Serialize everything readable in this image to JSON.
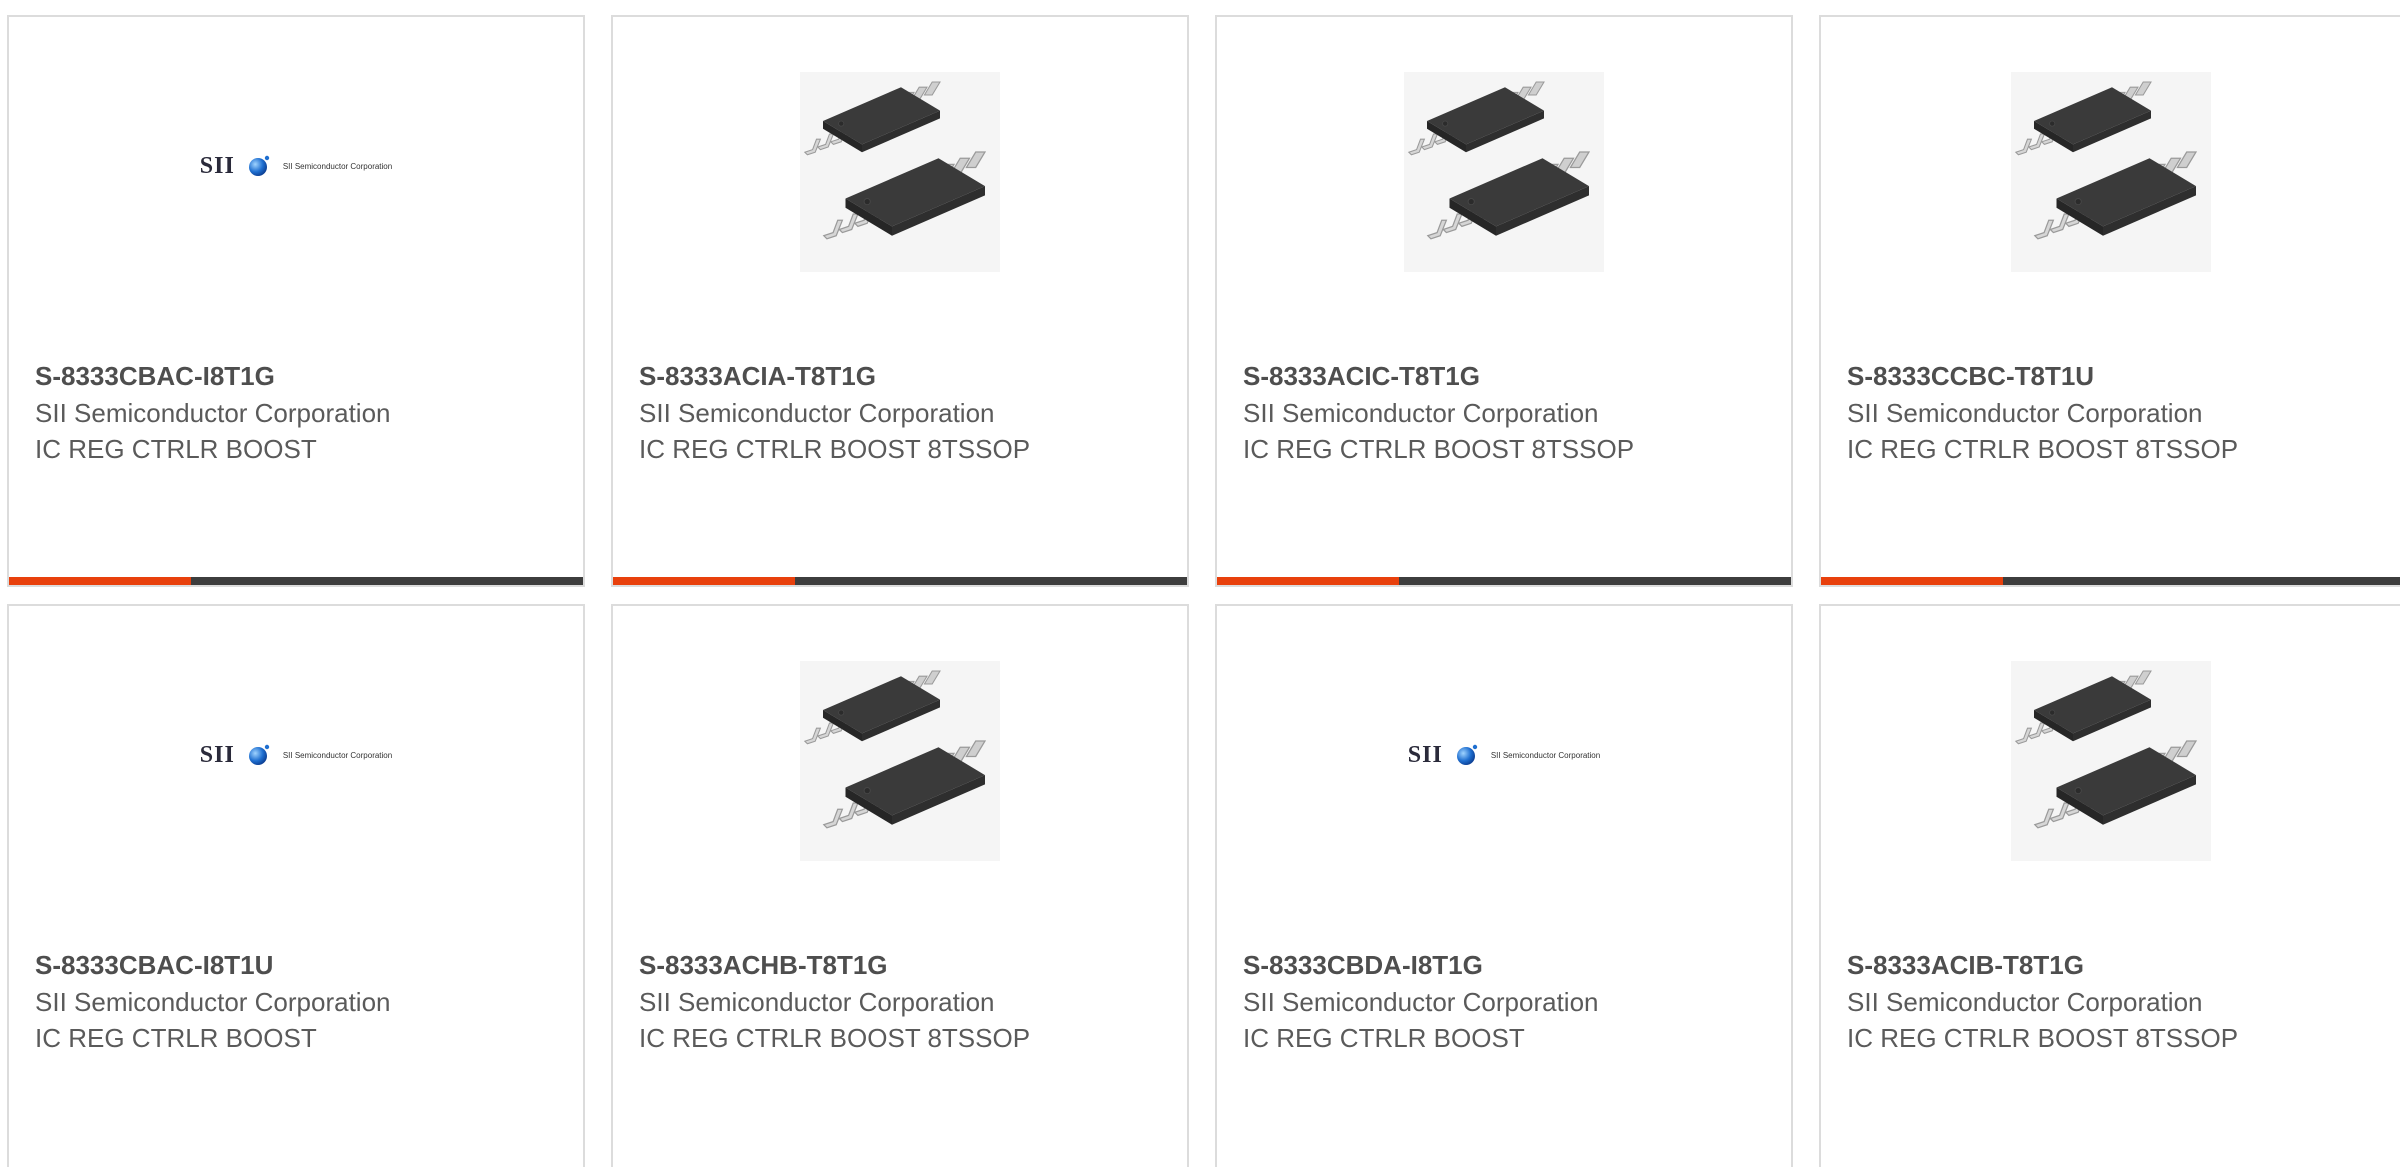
{
  "colors": {
    "accent": "#e8400c",
    "bar_dark": "#3d3d3d",
    "border": "#dcdcdc",
    "title": "#4e4e4e",
    "text": "#5a5a5a"
  },
  "products": [
    {
      "part_number": "S-8333CBAC-I8T1G",
      "manufacturer": "SII Semiconductor Corporation",
      "description": "IC REG CTRLR BOOST",
      "image": "sii-logo",
      "logo_text": "SII",
      "logo_sub": "SII Semiconductor Corporation"
    },
    {
      "part_number": "S-8333ACIA-T8T1G",
      "manufacturer": "SII Semiconductor Corporation",
      "description": "IC REG CTRLR BOOST 8TSSOP",
      "image": "tssop-chip"
    },
    {
      "part_number": "S-8333ACIC-T8T1G",
      "manufacturer": "SII Semiconductor Corporation",
      "description": "IC REG CTRLR BOOST 8TSSOP",
      "image": "tssop-chip"
    },
    {
      "part_number": "S-8333CCBC-T8T1U",
      "manufacturer": "SII Semiconductor Corporation",
      "description": "IC REG CTRLR BOOST 8TSSOP",
      "image": "tssop-chip"
    },
    {
      "part_number": "S-8333CBAC-I8T1U",
      "manufacturer": "SII Semiconductor Corporation",
      "description": "IC REG CTRLR BOOST",
      "image": "sii-logo",
      "logo_text": "SII",
      "logo_sub": "SII Semiconductor Corporation"
    },
    {
      "part_number": "S-8333ACHB-T8T1G",
      "manufacturer": "SII Semiconductor Corporation",
      "description": "IC REG CTRLR BOOST 8TSSOP",
      "image": "tssop-chip"
    },
    {
      "part_number": "S-8333CBDA-I8T1G",
      "manufacturer": "SII Semiconductor Corporation",
      "description": "IC REG CTRLR BOOST",
      "image": "sii-logo",
      "logo_text": "SII",
      "logo_sub": "SII Semiconductor Corporation"
    },
    {
      "part_number": "S-8333ACIB-T8T1G",
      "manufacturer": "SII Semiconductor Corporation",
      "description": "IC REG CTRLR BOOST 8TSSOP",
      "image": "tssop-chip"
    }
  ]
}
